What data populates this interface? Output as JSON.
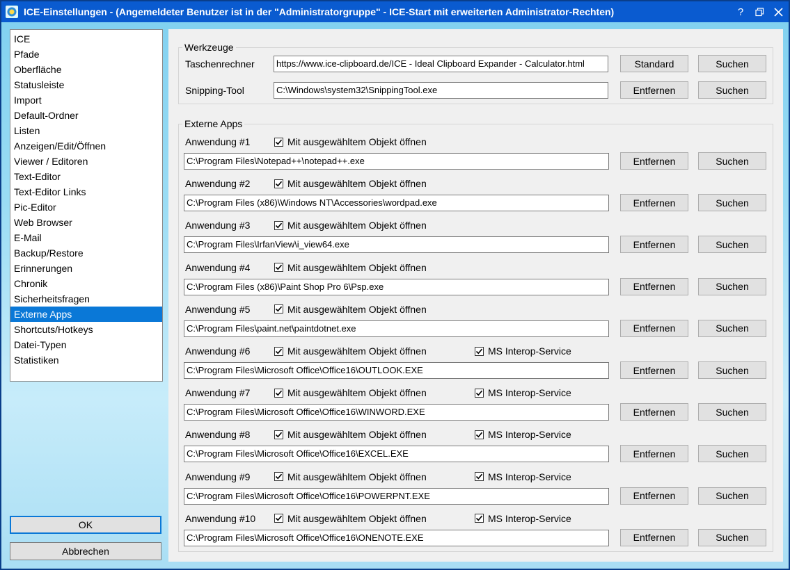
{
  "window": {
    "title": "ICE-Einstellungen - (Angemeldeter Benutzer ist in der \"Administratorgruppe\" - ICE-Start mit erweiterten Administrator-Rechten)",
    "help_glyph": "?"
  },
  "nav": {
    "items": [
      "ICE",
      "Pfade",
      "Oberfläche",
      "Statusleiste",
      "Import",
      "Default-Ordner",
      "Listen",
      "Anzeigen/Edit/Öffnen",
      "Viewer / Editoren",
      "Text-Editor",
      "Text-Editor Links",
      "Pic-Editor",
      "Web Browser",
      "E-Mail",
      "Backup/Restore",
      "Erinnerungen",
      "Chronik",
      "Sicherheitsfragen",
      "Externe Apps",
      "Shortcuts/Hotkeys",
      "Datei-Typen",
      "Statistiken"
    ],
    "selected": "Externe Apps"
  },
  "buttons": {
    "ok": "OK",
    "cancel": "Abbrechen"
  },
  "tools": {
    "title": "Werkzeuge",
    "calculator": {
      "label": "Taschenrechner",
      "value": "https://www.ice-clipboard.de/ICE - Ideal Clipboard Expander - Calculator.html",
      "left_button": "Standard",
      "right_button": "Suchen"
    },
    "snipping": {
      "label": "Snipping-Tool",
      "value": "C:\\Windows\\system32\\SnippingTool.exe",
      "left_button": "Entfernen",
      "right_button": "Suchen"
    }
  },
  "external": {
    "title": "Externe Apps",
    "open_label": "Mit ausgewähltem Objekt öffnen",
    "interop_label": "MS Interop-Service",
    "remove_label": "Entfernen",
    "search_label": "Suchen",
    "apps": [
      {
        "label": "Anwendung #1",
        "path": "C:\\Program Files\\Notepad++\\notepad++.exe",
        "open": true
      },
      {
        "label": "Anwendung #2",
        "path": "C:\\Program Files (x86)\\Windows NT\\Accessories\\wordpad.exe",
        "open": true
      },
      {
        "label": "Anwendung #3",
        "path": "C:\\Program Files\\IrfanView\\i_view64.exe",
        "open": true
      },
      {
        "label": "Anwendung #4",
        "path": "C:\\Program Files (x86)\\Paint Shop Pro 6\\Psp.exe",
        "open": true
      },
      {
        "label": "Anwendung #5",
        "path": "C:\\Program Files\\paint.net\\paintdotnet.exe",
        "open": true
      },
      {
        "label": "Anwendung #6",
        "path": "C:\\Program Files\\Microsoft Office\\Office16\\OUTLOOK.EXE",
        "open": true,
        "interop": true
      },
      {
        "label": "Anwendung #7",
        "path": "C:\\Program Files\\Microsoft Office\\Office16\\WINWORD.EXE",
        "open": true,
        "interop": true
      },
      {
        "label": "Anwendung #8",
        "path": "C:\\Program Files\\Microsoft Office\\Office16\\EXCEL.EXE",
        "open": true,
        "interop": true
      },
      {
        "label": "Anwendung #9",
        "path": "C:\\Program Files\\Microsoft Office\\Office16\\POWERPNT.EXE",
        "open": true,
        "interop": true
      },
      {
        "label": "Anwendung #10",
        "path": "C:\\Program Files\\Microsoft Office\\Office16\\ONENOTE.EXE",
        "open": true,
        "interop": true
      }
    ]
  },
  "colors": {
    "titlebar": "#0a5bd0",
    "selection": "#0a78d7"
  }
}
